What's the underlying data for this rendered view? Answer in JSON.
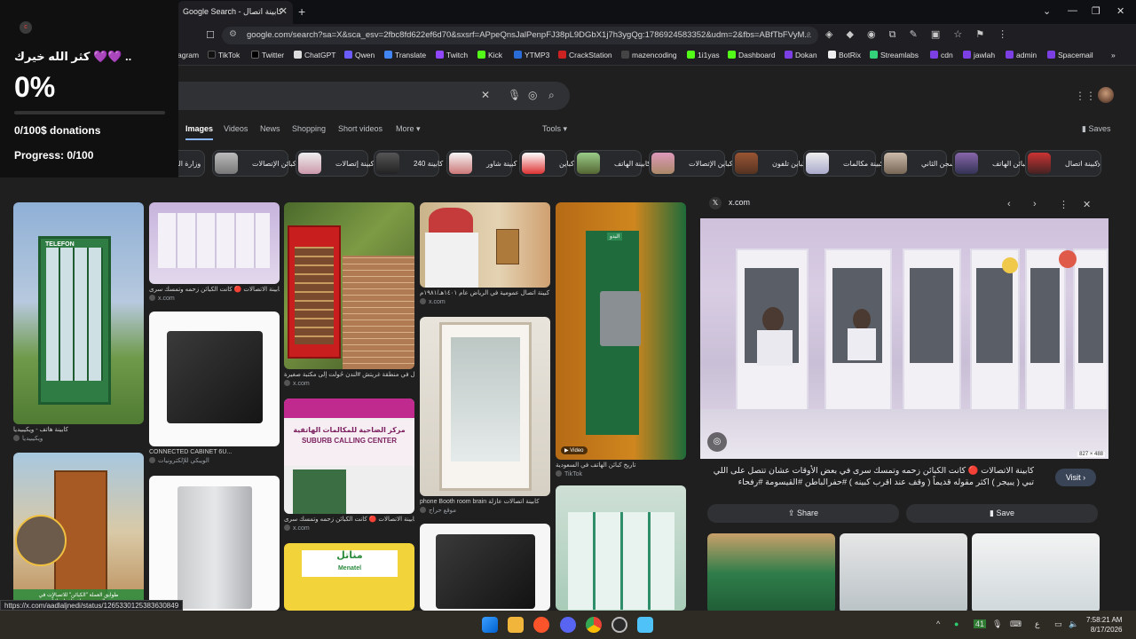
{
  "browser": {
    "tab_title": "Google Search - كابينة اتصال",
    "url": "google.com/search?sa=X&sca_esv=2fbc8fd622ef6d70&sxsrf=APpeQnsJalPenpFJ38pL9DGbX1j7h3ygQg:1786924583352&udm=2&fbs=ABfTbFVyM..."
  },
  "bookmarks": [
    "agram",
    "TikTok",
    "Twitter",
    "ChatGPT",
    "Qwen",
    "Translate",
    "Twitch",
    "Kick",
    "YTMP3",
    "CrackStation",
    "mazencoding",
    "1i1yas",
    "Dashboard",
    "Dokan",
    "BotRix",
    "Streamlabs",
    "cdn",
    "jawlah",
    "admin",
    "Spacemail"
  ],
  "nav": {
    "images": "Images",
    "videos": "Videos",
    "news": "News",
    "shopping": "Shopping",
    "short_videos": "Short videos",
    "more": "More",
    "tools": "Tools",
    "saves": "Saves"
  },
  "chips": [
    "وزارة الم",
    "كبائن الإتصالات",
    "كبينة إتصالات",
    "240 كابينة",
    "كبينة شاور",
    "كباين",
    "كابينة الهاتف",
    "كباين الإتصالات",
    "كباين تلفون",
    "كبينة مكالمات",
    "سجن الثاني",
    "كبائن الهاتف",
    "كبينة اتصال"
  ],
  "results": {
    "c1_cap": "كابينة هاتف - ويكيبيديا",
    "c1_src": "ويكيبيديا",
    "c2_cap": "كابينة الاتصالات 🔴 كانت الكبائن زحمه وتمسك سرى ...",
    "c2_src": "x.com",
    "c3_cap": "كابينة اتصال في منطقة غريتش #لندن حُولت إلى مكتبة صغيرة",
    "c3_src": "x.com",
    "c4_cap": "كبينة اتصال عمومية في الرياض عام ١٤٠١هـ/١٩٨١م",
    "c4_src": "x.com",
    "c5_cap": "تاريخ كبائن الهاتف في السعودية",
    "c5_src": "TikTok",
    "c5_video": "Video",
    "c6_cap": "CONNECTED CABINET 6U...",
    "c6_src": "الويبكي للإلكترونيات",
    "c7_cap": "كابينة الاتصالات 🔴 كانت الكبائن زحمه وتمسك سرى ...",
    "c7_src": "x.com",
    "c8_cap": "phone Booth room brain كابينة اتصالات عازلة",
    "c8_src": "موقع حراج",
    "sign1": "مركز الضاحية للمكالمات الهاتفية",
    "sign2": "SUBURB CALLING CENTER",
    "telefon": "TELEFON",
    "mena": "مناتل",
    "mena_en": "Menatel",
    "phone_label": "البدو"
  },
  "panel": {
    "source": "x.com",
    "dims": "827 × 488",
    "text": "كابينة الاتصالات 🔴 كانت الكبائن زحمه وتمسك سرى في بعض الأوقات عشان تتصل على اللي تبي ( يبيجر ) اكثر مقوله قديماً ( وقف عند اقرب كبينه ) #حفرالباطن #القيسومة #رفحاء",
    "visit": "Visit",
    "share": "Share",
    "save": "Save"
  },
  "overlay": {
    "thanks": "كثر الله خيرك 💜💜 ..",
    "percent": "0%",
    "donations": "0/100$ donations",
    "progress": "Progress: 0/100",
    "progress_fraction": 0
  },
  "status_url": "https://x.com/aadlaljnedi/status/1265330125383630849",
  "tray": {
    "time": "7:58:21 AM",
    "date": "8/17/2026",
    "lang": "ع"
  }
}
